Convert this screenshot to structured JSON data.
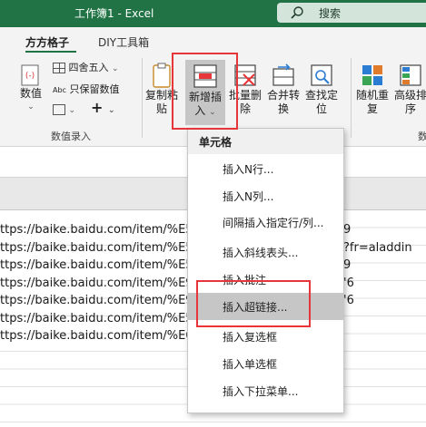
{
  "window": {
    "title": "工作簿1  -  Excel",
    "search_label": "搜索"
  },
  "tabs": [
    {
      "label": "方方格子",
      "active": true
    },
    {
      "label": "DIY工具箱",
      "active": false
    }
  ],
  "ribbon": {
    "value_button": "数值",
    "round_label": "四舍五入",
    "keep_value_label": "只保留数值",
    "abc_label": "Abc",
    "group_value_entry": "数值录入",
    "copy_paste": [
      "复制粘",
      "贴"
    ],
    "new_insert": [
      "新增插",
      "入"
    ],
    "batch_delete": [
      "批量删",
      "除"
    ],
    "merge_convert": [
      "合并转",
      "换"
    ],
    "find_locate": [
      "查找定",
      "位"
    ],
    "random_repeat": [
      "随机重",
      "复"
    ],
    "advanced_sort": [
      "高级排",
      "序"
    ],
    "right_fragment": "数"
  },
  "sheet": {
    "url_rows": [
      "ttps://baike.baidu.com/item/%E5",
      "ttps://baike.baidu.com/item/%E5",
      "ttps://baike.baidu.com/item/%E5",
      "ttps://baike.baidu.com/item/%E9",
      "ttps://baike.baidu.com/item/%E9",
      "ttps://baike.baidu.com/item/%E5",
      "ttps://baike.baidu.com/item/%E6"
    ],
    "right_fragments": [
      "9",
      "?fr=aladdin",
      "9",
      "'6",
      "'6"
    ]
  },
  "menu": {
    "header": "单元格",
    "items": [
      "插入N行...",
      "插入N列...",
      "间隔插入指定行/列...",
      "插入斜线表头...",
      "插入批注",
      "插入超链接...",
      "插入复选框",
      "插入单选框",
      "插入下拉菜单..."
    ],
    "hovered_index": 5
  },
  "colors": {
    "accent": "#217346",
    "highlight": "#e8353a",
    "menu_hover": "#c6c6c6"
  }
}
